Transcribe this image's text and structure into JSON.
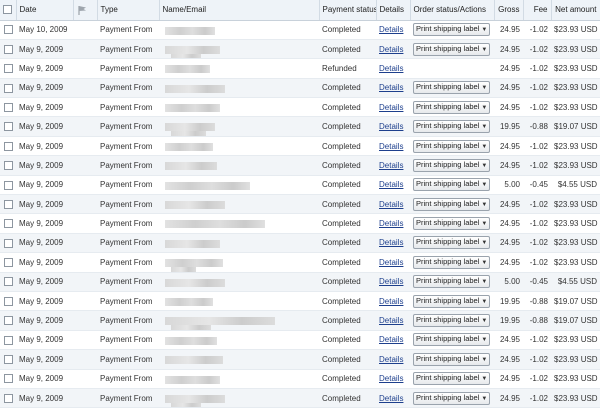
{
  "header": {
    "date": "Date",
    "type": "Type",
    "name_email": "Name/Email",
    "payment_status": "Payment status",
    "details": "Details",
    "order_status_actions": "Order status/Actions",
    "gross": "Gross",
    "fee": "Fee",
    "net_amount": "Net amount",
    "flag_icon": "flag-icon"
  },
  "action_label": "Print shipping label",
  "details_label": "Details",
  "rows": [
    {
      "date": "May 10, 2009",
      "type": "Payment From",
      "status": "Completed",
      "has_action": true,
      "gross": "24.95",
      "fee": "-1.02",
      "net": "$23.93 USD"
    },
    {
      "date": "May 9, 2009",
      "type": "Payment From",
      "status": "Completed",
      "has_action": true,
      "gross": "24.95",
      "fee": "-1.02",
      "net": "$23.93 USD"
    },
    {
      "date": "May 9, 2009",
      "type": "Payment From",
      "status": "Refunded",
      "has_action": false,
      "gross": "24.95",
      "fee": "-1.02",
      "net": "$23.93 USD"
    },
    {
      "date": "May 9, 2009",
      "type": "Payment From",
      "status": "Completed",
      "has_action": true,
      "gross": "24.95",
      "fee": "-1.02",
      "net": "$23.93 USD"
    },
    {
      "date": "May 9, 2009",
      "type": "Payment From",
      "status": "Completed",
      "has_action": true,
      "gross": "24.95",
      "fee": "-1.02",
      "net": "$23.93 USD"
    },
    {
      "date": "May 9, 2009",
      "type": "Payment From",
      "status": "Completed",
      "has_action": true,
      "gross": "19.95",
      "fee": "-0.88",
      "net": "$19.07 USD"
    },
    {
      "date": "May 9, 2009",
      "type": "Payment From",
      "status": "Completed",
      "has_action": true,
      "gross": "24.95",
      "fee": "-1.02",
      "net": "$23.93 USD"
    },
    {
      "date": "May 9, 2009",
      "type": "Payment From",
      "status": "Completed",
      "has_action": true,
      "gross": "24.95",
      "fee": "-1.02",
      "net": "$23.93 USD"
    },
    {
      "date": "May 9, 2009",
      "type": "Payment From",
      "status": "Completed",
      "has_action": true,
      "gross": "5.00",
      "fee": "-0.45",
      "net": "$4.55 USD"
    },
    {
      "date": "May 9, 2009",
      "type": "Payment From",
      "status": "Completed",
      "has_action": true,
      "gross": "24.95",
      "fee": "-1.02",
      "net": "$23.93 USD"
    },
    {
      "date": "May 9, 2009",
      "type": "Payment From",
      "status": "Completed",
      "has_action": true,
      "gross": "24.95",
      "fee": "-1.02",
      "net": "$23.93 USD"
    },
    {
      "date": "May 9, 2009",
      "type": "Payment From",
      "status": "Completed",
      "has_action": true,
      "gross": "24.95",
      "fee": "-1.02",
      "net": "$23.93 USD"
    },
    {
      "date": "May 9, 2009",
      "type": "Payment From",
      "status": "Completed",
      "has_action": true,
      "gross": "24.95",
      "fee": "-1.02",
      "net": "$23.93 USD"
    },
    {
      "date": "May 9, 2009",
      "type": "Payment From",
      "status": "Completed",
      "has_action": true,
      "gross": "5.00",
      "fee": "-0.45",
      "net": "$4.55 USD"
    },
    {
      "date": "May 9, 2009",
      "type": "Payment From",
      "status": "Completed",
      "has_action": true,
      "gross": "19.95",
      "fee": "-0.88",
      "net": "$19.07 USD"
    },
    {
      "date": "May 9, 2009",
      "type": "Payment From",
      "status": "Completed",
      "has_action": true,
      "gross": "19.95",
      "fee": "-0.88",
      "net": "$19.07 USD"
    },
    {
      "date": "May 9, 2009",
      "type": "Payment From",
      "status": "Completed",
      "has_action": true,
      "gross": "24.95",
      "fee": "-1.02",
      "net": "$23.93 USD"
    },
    {
      "date": "May 9, 2009",
      "type": "Payment From",
      "status": "Completed",
      "has_action": true,
      "gross": "24.95",
      "fee": "-1.02",
      "net": "$23.93 USD"
    },
    {
      "date": "May 9, 2009",
      "type": "Payment From",
      "status": "Completed",
      "has_action": true,
      "gross": "24.95",
      "fee": "-1.02",
      "net": "$23.93 USD"
    },
    {
      "date": "May 9, 2009",
      "type": "Payment From",
      "status": "Completed",
      "has_action": true,
      "gross": "24.95",
      "fee": "-1.02",
      "net": "$23.93 USD"
    }
  ]
}
